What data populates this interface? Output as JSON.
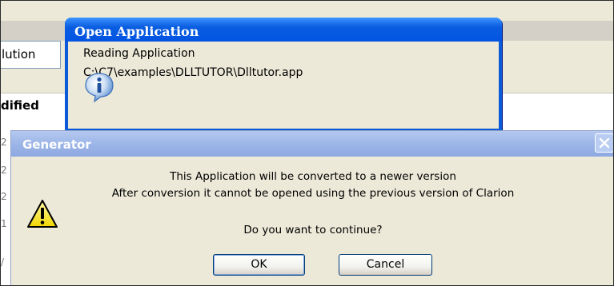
{
  "background": {
    "solution_fragment": "lution",
    "modified_fragment": "dified"
  },
  "open_dialog": {
    "title": "Open Application",
    "line1": "Reading Application",
    "line2": "C:\\C7\\examples\\DLLTUTOR\\Dlltutor.app",
    "icon": "info-icon"
  },
  "generator_dialog": {
    "title": "Generator",
    "message_line1": "This Application will be converted to a newer version",
    "message_line2": "After conversion it cannot be opened using the previous version of Clarion",
    "question": "Do you want to continue?",
    "ok_label": "OK",
    "cancel_label": "Cancel",
    "icon": "warning-icon"
  },
  "colors": {
    "xp_blue": "#0054e3",
    "inactive_title": "#9db6e8",
    "dialog_face": "#ece9d8"
  }
}
